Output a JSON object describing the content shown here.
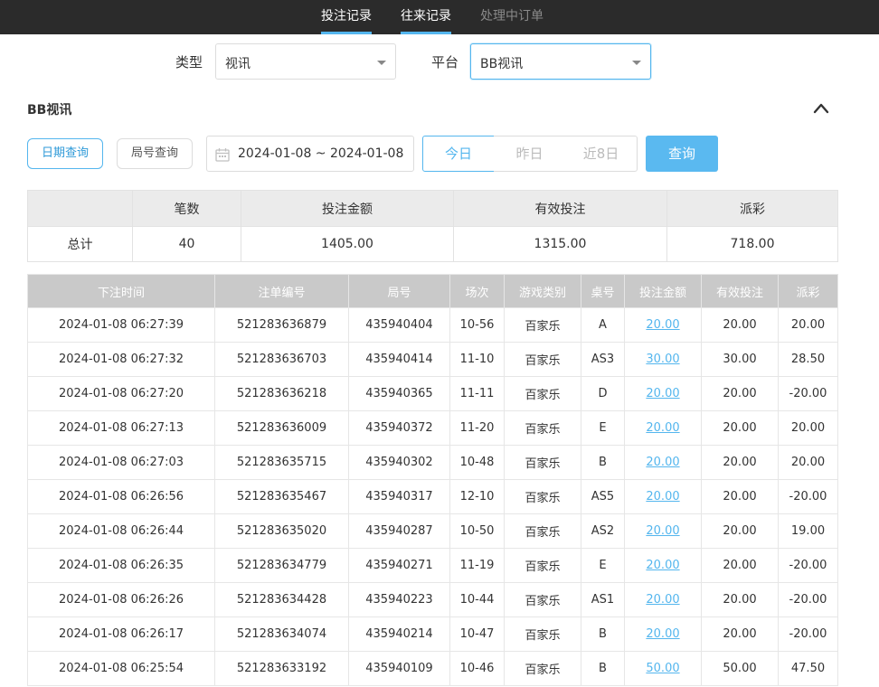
{
  "nav": {
    "tabs": [
      {
        "label": "投注记录"
      },
      {
        "label": "往来记录"
      },
      {
        "label": "处理中订单"
      }
    ]
  },
  "filters": {
    "type_label": "类型",
    "type_value": "视讯",
    "platform_label": "平台",
    "platform_value": "BB视讯"
  },
  "section": {
    "title": "BB视讯"
  },
  "search": {
    "date_query_label": "日期查询",
    "round_query_label": "局号查询",
    "date_range": "2024-01-08 ~ 2024-01-08",
    "quick": [
      "今日",
      "昨日",
      "近8日"
    ],
    "query_label": "查询"
  },
  "summary": {
    "headers": [
      "",
      "笔数",
      "投注金额",
      "有效投注",
      "派彩"
    ],
    "row": [
      "总计",
      "40",
      "1405.00",
      "1315.00",
      "718.00"
    ]
  },
  "records": {
    "headers": [
      "下注时间",
      "注单编号",
      "局号",
      "场次",
      "游戏类别",
      "桌号",
      "投注金额",
      "有效投注",
      "派彩"
    ],
    "rows": [
      [
        "2024-01-08 06:27:39",
        "521283636879",
        "435940404",
        "10-56",
        "百家乐",
        "A",
        "20.00",
        "20.00",
        "20.00"
      ],
      [
        "2024-01-08 06:27:32",
        "521283636703",
        "435940414",
        "11-10",
        "百家乐",
        "AS3",
        "30.00",
        "30.00",
        "28.50"
      ],
      [
        "2024-01-08 06:27:20",
        "521283636218",
        "435940365",
        "11-11",
        "百家乐",
        "D",
        "20.00",
        "20.00",
        "-20.00"
      ],
      [
        "2024-01-08 06:27:13",
        "521283636009",
        "435940372",
        "11-20",
        "百家乐",
        "E",
        "20.00",
        "20.00",
        "20.00"
      ],
      [
        "2024-01-08 06:27:03",
        "521283635715",
        "435940302",
        "10-48",
        "百家乐",
        "B",
        "20.00",
        "20.00",
        "20.00"
      ],
      [
        "2024-01-08 06:26:56",
        "521283635467",
        "435940317",
        "12-10",
        "百家乐",
        "AS5",
        "20.00",
        "20.00",
        "-20.00"
      ],
      [
        "2024-01-08 06:26:44",
        "521283635020",
        "435940287",
        "10-50",
        "百家乐",
        "AS2",
        "20.00",
        "20.00",
        "19.00"
      ],
      [
        "2024-01-08 06:26:35",
        "521283634779",
        "435940271",
        "11-19",
        "百家乐",
        "E",
        "20.00",
        "20.00",
        "-20.00"
      ],
      [
        "2024-01-08 06:26:26",
        "521283634428",
        "435940223",
        "10-44",
        "百家乐",
        "AS1",
        "20.00",
        "20.00",
        "-20.00"
      ],
      [
        "2024-01-08 06:26:17",
        "521283634074",
        "435940214",
        "10-47",
        "百家乐",
        "B",
        "20.00",
        "20.00",
        "-20.00"
      ],
      [
        "2024-01-08 06:25:54",
        "521283633192",
        "435940109",
        "10-46",
        "百家乐",
        "B",
        "50.00",
        "50.00",
        "47.50"
      ]
    ]
  },
  "colors": {
    "accent": "#54b6ee",
    "negative": "#e0415a",
    "nav_bg": "#2b2b2b"
  }
}
